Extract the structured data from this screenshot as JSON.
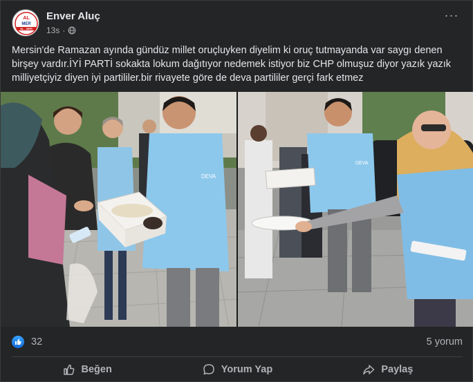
{
  "post": {
    "author": "Enver Aluç",
    "time": "13s",
    "more_label": "···",
    "text": "Mersin'de Ramazan ayında gündüz millet oruçluyken diyelim ki oruç tutmayanda var saygı denen birşey vardır.İYİ PARTİ sokakta lokum dağıtıyor nedemek istiyor biz CHP olmuşuz diyor yazık yazık milliyetçiyiz diyen iyi partililer.bir rivayete göre de deva partililer gerçi fark etmez"
  },
  "avatar": {
    "line1": "AL",
    "line2": "MER",
    "line3": "AL - MER"
  },
  "photos": [
    {
      "name": "photo-left-lokum-box",
      "vest_text": "DEVA"
    },
    {
      "name": "photo-right-lokum-box",
      "vest_text": "DEVA"
    }
  ],
  "reactions": {
    "like_count": "32",
    "comment_count": "5 yorum"
  },
  "actions": {
    "like": "Beğen",
    "comment": "Yorum Yap",
    "share": "Paylaş"
  },
  "colors": {
    "background": "#242526",
    "text": "#e4e6eb",
    "secondary": "#b0b3b8",
    "like_blue": "#1877f2"
  },
  "icons": [
    "globe-icon",
    "more-icon",
    "like-reaction-icon",
    "thumb-up-icon",
    "comment-icon",
    "share-icon"
  ]
}
